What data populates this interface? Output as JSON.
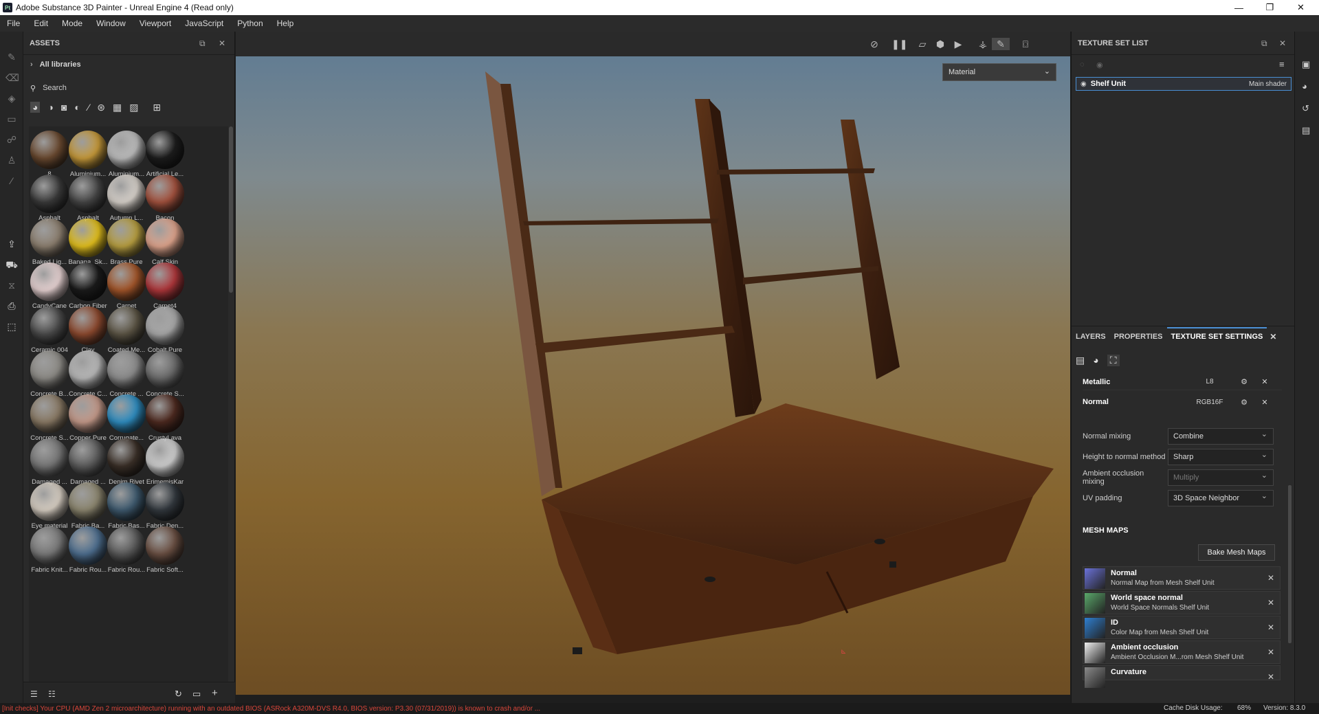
{
  "window": {
    "title": "Adobe Substance 3D Painter - Unreal Engine 4 (Read only)",
    "app_icon": "Pt"
  },
  "menu": [
    "File",
    "Edit",
    "Mode",
    "Window",
    "Viewport",
    "JavaScript",
    "Python",
    "Help"
  ],
  "assets_panel": {
    "title": "ASSETS",
    "library": "All libraries",
    "search_placeholder": "Search",
    "items": [
      {
        "label": "8",
        "color": "#6b4a30"
      },
      {
        "label": "Aluminium...",
        "color": "#c79a3a"
      },
      {
        "label": "Aluminium...",
        "color": "#bdbdbd"
      },
      {
        "label": "Artificial Le...",
        "color": "#1d1d1d"
      },
      {
        "label": "Asphalt",
        "color": "#3a3a3a"
      },
      {
        "label": "Asphalt",
        "color": "#454545"
      },
      {
        "label": "Autumn L...",
        "color": "#d8d2cb"
      },
      {
        "label": "Bacon",
        "color": "#a4523e"
      },
      {
        "label": "Baked Lig...",
        "color": "#8d8070"
      },
      {
        "label": "Banana_Sk...",
        "color": "#e4c11d"
      },
      {
        "label": "Brass Pure",
        "color": "#b9a041"
      },
      {
        "label": "Calf Skin",
        "color": "#e0a58d"
      },
      {
        "label": "CandyCane",
        "color": "#e8d3d3"
      },
      {
        "label": "Carbon Fiber",
        "color": "#1b1b1b"
      },
      {
        "label": "Carpet",
        "color": "#a4562a"
      },
      {
        "label": "Carpet4",
        "color": "#b0373b"
      },
      {
        "label": "Ceramic 004",
        "color": "#4b4b4b"
      },
      {
        "label": "Clay",
        "color": "#8e4a2f"
      },
      {
        "label": "Coated Me...",
        "color": "#5c5545"
      },
      {
        "label": "Cobalt Pure",
        "color": "#a9a9a9"
      },
      {
        "label": "Concrete B...",
        "color": "#8e8c87"
      },
      {
        "label": "Concrete C...",
        "color": "#b9b9b9"
      },
      {
        "label": "Concrete ...",
        "color": "#8d8d8d"
      },
      {
        "label": "Concrete S...",
        "color": "#6c6c6c"
      },
      {
        "label": "Concrete S...",
        "color": "#8a7a65"
      },
      {
        "label": "Copper Pure",
        "color": "#c59a8a"
      },
      {
        "label": "Corrugate...",
        "color": "#2f8ec2"
      },
      {
        "label": "CrustyLava",
        "color": "#4e2a20"
      },
      {
        "label": "Damaged ...",
        "color": "#777777"
      },
      {
        "label": "Damaged ...",
        "color": "#5d5d5d"
      },
      {
        "label": "Denim Rivet",
        "color": "#3b3028"
      },
      {
        "label": "ErimemisKar",
        "color": "#cfcfcf"
      },
      {
        "label": "Eye material",
        "color": "#d8cfc3"
      },
      {
        "label": "Fabric Ba...",
        "color": "#8d8770"
      },
      {
        "label": "Fabric Bas...",
        "color": "#3f5b70"
      },
      {
        "label": "Fabric Den...",
        "color": "#33393f"
      },
      {
        "label": "Fabric Knit...",
        "color": "#7a7a7a"
      },
      {
        "label": "Fabric Rou...",
        "color": "#4e6f90"
      },
      {
        "label": "Fabric Rou...",
        "color": "#5a5a5a"
      },
      {
        "label": "Fabric Soft...",
        "color": "#6b5043"
      }
    ]
  },
  "viewport": {
    "display_mode": "Material"
  },
  "texture_set_list": {
    "title": "TEXTURE SET LIST",
    "rows": [
      {
        "name": "Shelf Unit",
        "shader": "Main shader"
      }
    ]
  },
  "tabs": [
    "LAYERS",
    "PROPERTIES",
    "TEXTURE SET SETTINGS"
  ],
  "channels": [
    {
      "name": "Metallic",
      "format": "L8"
    },
    {
      "name": "Normal",
      "format": "RGB16F"
    }
  ],
  "settings": [
    {
      "label": "Normal mixing",
      "value": "Combine",
      "disabled": false
    },
    {
      "label": "Height to normal method",
      "value": "Sharp",
      "disabled": false
    },
    {
      "label": "Ambient occlusion mixing",
      "value": "Multiply",
      "disabled": true
    },
    {
      "label": "UV padding",
      "value": "3D Space Neighbor",
      "disabled": false
    }
  ],
  "mesh_maps": {
    "title": "MESH MAPS",
    "bake_button": "Bake Mesh Maps",
    "items": [
      {
        "name": "Normal",
        "desc": "Normal Map from Mesh Shelf Unit",
        "thumb": "#6b72d9"
      },
      {
        "name": "World space normal",
        "desc": "World Space Normals Shelf Unit",
        "thumb": "#5aa86a"
      },
      {
        "name": "ID",
        "desc": "Color Map from Mesh Shelf Unit",
        "thumb": "#2f7fd0"
      },
      {
        "name": "Ambient occlusion",
        "desc": "Ambient Occlusion M...rom Mesh Shelf Unit",
        "thumb": "#f0f0f0"
      },
      {
        "name": "Curvature",
        "desc": "",
        "thumb": "#8a8a8a"
      }
    ]
  },
  "status": {
    "error": "[Init checks] Your CPU (AMD Zen 2 microarchitecture) running with an outdated BIOS (ASRock A320M-DVS R4.0, BIOS version: P3.30 (07/31/2019)) is known to crash and/or ...",
    "cache_label": "Cache Disk Usage:",
    "cache_value": "68%",
    "version": "Version: 8.3.0"
  }
}
